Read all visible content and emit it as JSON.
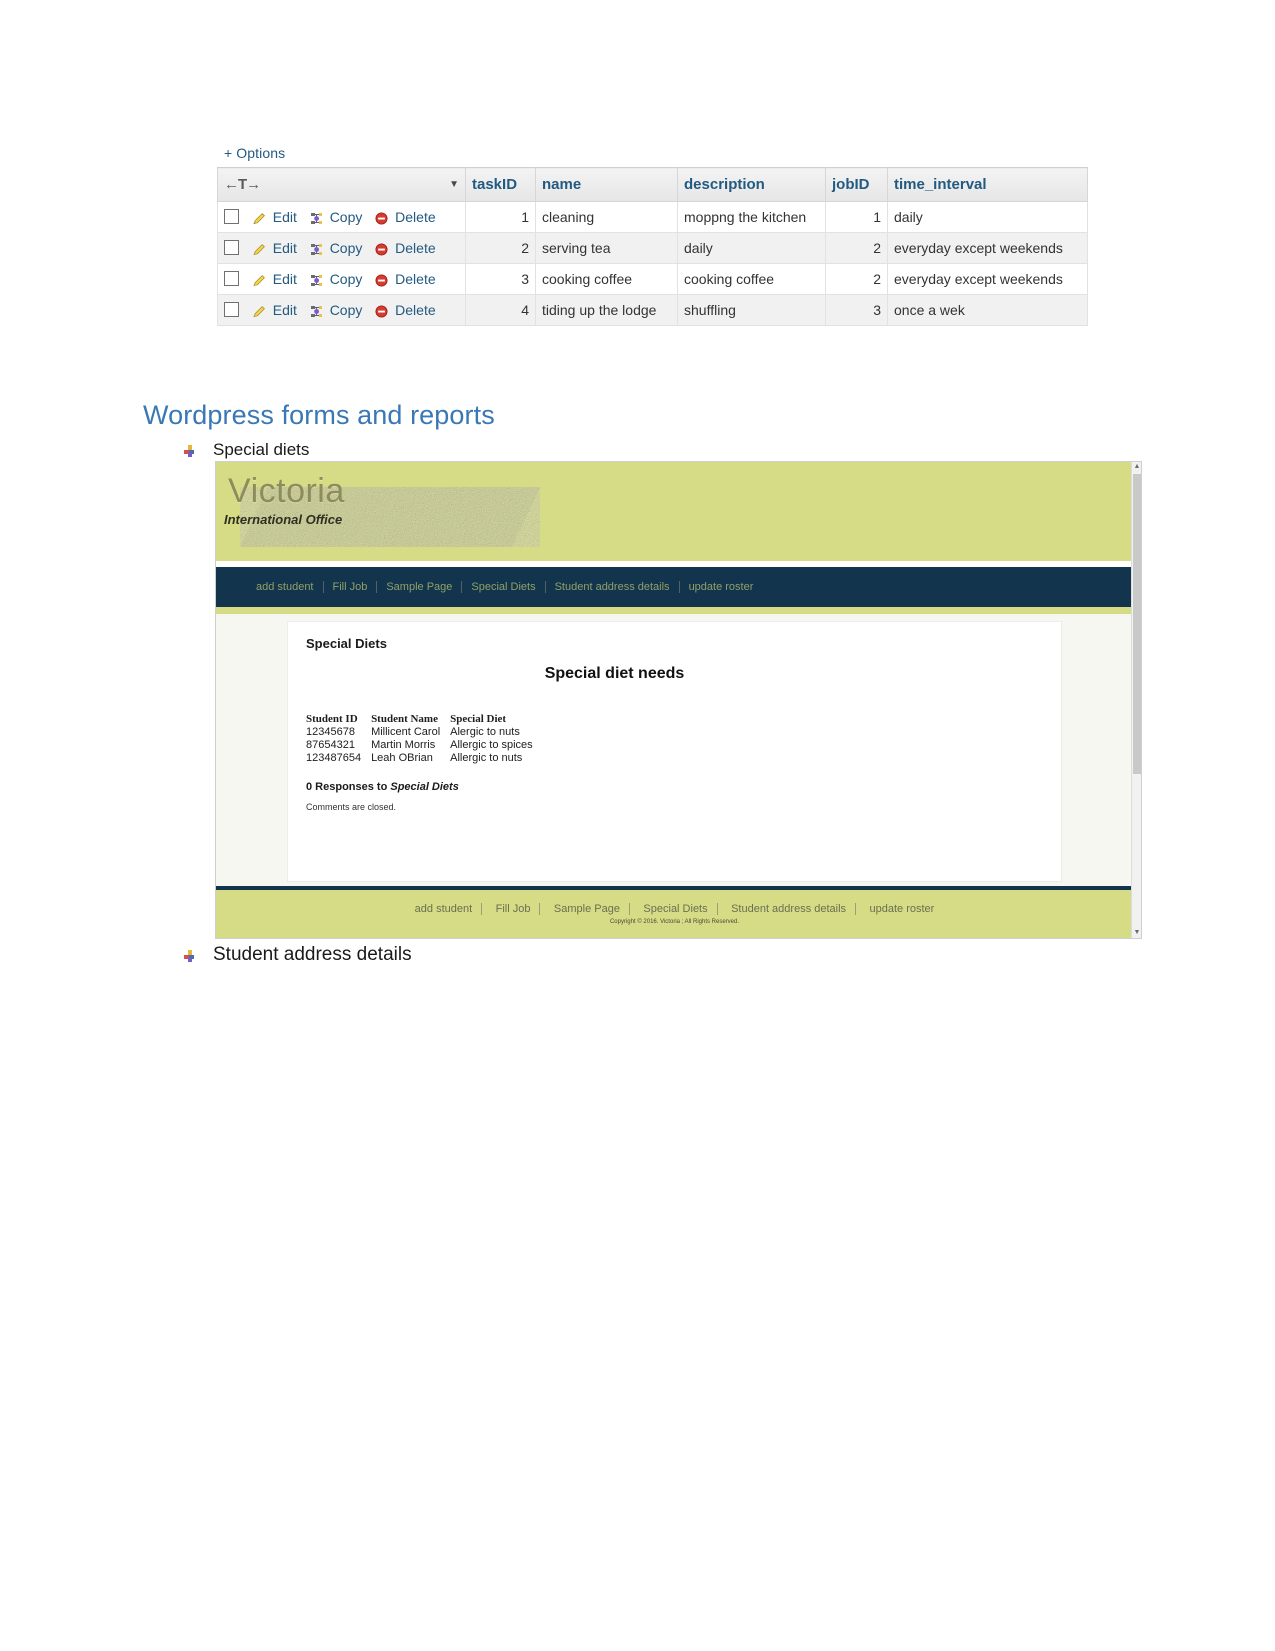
{
  "phpmyadmin": {
    "options_label": "+ Options",
    "sort_arrows": "←T→",
    "columns": [
      "taskID",
      "name",
      "description",
      "jobID",
      "time_interval"
    ],
    "row_actions": {
      "edit": "Edit",
      "copy": "Copy",
      "delete": "Delete"
    },
    "rows": [
      {
        "taskID": "1",
        "name": "cleaning",
        "description": "moppng the kitchen",
        "jobID": "1",
        "time_interval": "daily"
      },
      {
        "taskID": "2",
        "name": "serving tea",
        "description": "daily",
        "jobID": "2",
        "time_interval": "everyday except weekends"
      },
      {
        "taskID": "3",
        "name": "cooking coffee",
        "description": "cooking coffee",
        "jobID": "2",
        "time_interval": "everyday except weekends"
      },
      {
        "taskID": "4",
        "name": "tiding up the lodge",
        "description": "shuffling",
        "jobID": "3",
        "time_interval": "once a wek"
      }
    ]
  },
  "document": {
    "heading": "Wordpress forms and reports",
    "bullets": [
      {
        "label": "Special diets"
      },
      {
        "label": "Student address details"
      }
    ]
  },
  "wordpress": {
    "brand": "Victoria",
    "brand_sub": "International Office",
    "nav": [
      "add student",
      "Fill Job",
      "Sample Page",
      "Special Diets",
      "Student address details",
      "update roster"
    ],
    "post_title": "Special Diets",
    "post_heading": "Special diet needs",
    "table": {
      "headers": [
        "Student ID",
        "Student Name",
        "Special Diet"
      ],
      "rows": [
        [
          "12345678",
          "Millicent Carol",
          "Alergic to nuts"
        ],
        [
          "87654321",
          "Martin Morris",
          "Allergic to spices"
        ],
        [
          "123487654",
          "Leah OBrian",
          "Allergic to nuts"
        ]
      ]
    },
    "responses_count": "0 Responses to ",
    "responses_target": "Special Diets",
    "comments_closed": "Comments are closed.",
    "footer_nav": [
      "add student",
      "Fill Job",
      "Sample Page",
      "Special Diets",
      "Student address details",
      "update roster"
    ],
    "copyright": "Copyright © 2016. Victoria ; All Rights Reserved.",
    "scroll_up_icon": "▲",
    "scroll_down_icon": "▼"
  },
  "colors": {
    "pma_header_text": "#235a81",
    "wp_olive": "#d6dc86",
    "wp_navy": "#12344c",
    "doc_heading": "#3a78b5"
  }
}
